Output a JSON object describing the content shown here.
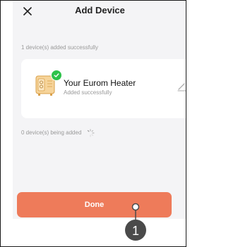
{
  "header": {
    "title": "Add Device",
    "close_icon": "close-icon"
  },
  "added_section": {
    "label": "1 device(s) added successfully",
    "device": {
      "name": "Your Eurom Heater",
      "status": "Added successfully",
      "thumbnail_icon": "heater-icon",
      "badge_icon": "check-icon",
      "edit_icon": "pencil-icon"
    }
  },
  "pending_section": {
    "label": "0 device(s) being added",
    "spinner_icon": "loading-spinner-icon"
  },
  "done_button": {
    "label": "Done"
  },
  "annotation": {
    "step_number": "1"
  },
  "colors": {
    "accent": "#ee7b5a",
    "success": "#2ec24a",
    "background": "#f4f4f6",
    "card": "#ffffff",
    "marker": "#4a4a4a"
  }
}
